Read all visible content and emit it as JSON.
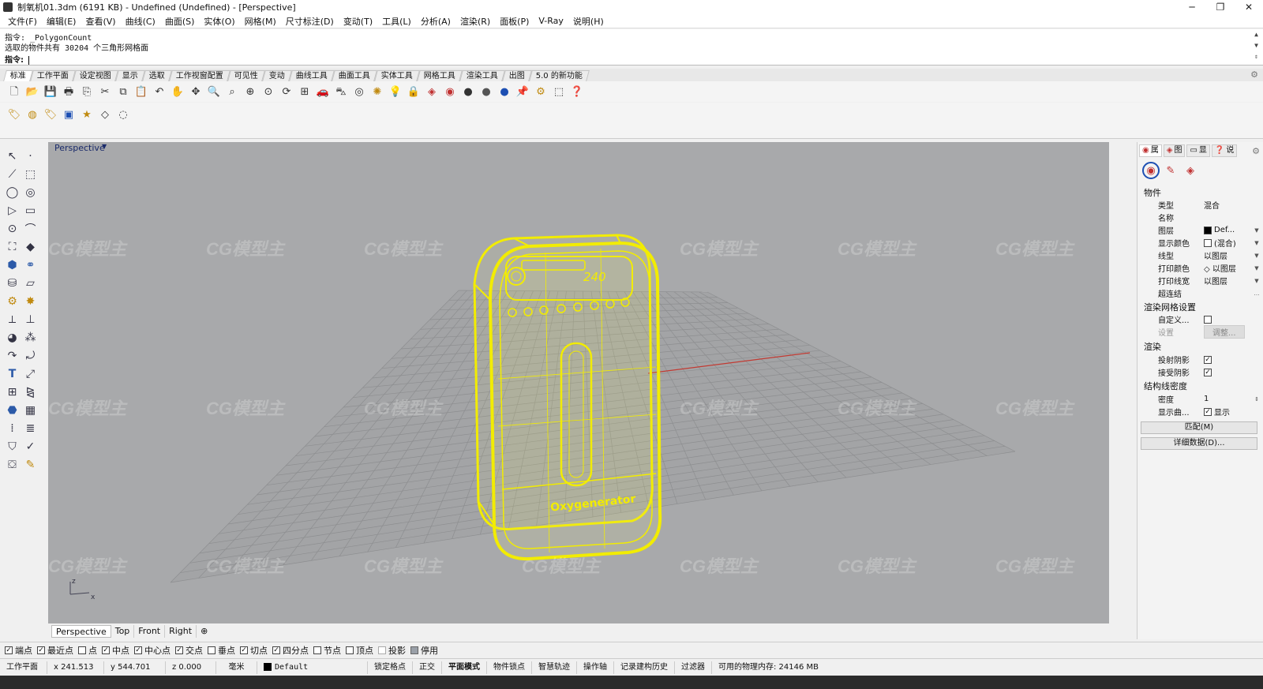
{
  "window": {
    "title": "制氧机01.3dm (6191 KB) - Undefined (Undefined) - [Perspective]",
    "controls": [
      "─",
      "❐",
      "✕"
    ]
  },
  "menu": [
    "文件(F)",
    "编辑(E)",
    "查看(V)",
    "曲线(C)",
    "曲面(S)",
    "实体(O)",
    "网格(M)",
    "尺寸标注(D)",
    "变动(T)",
    "工具(L)",
    "分析(A)",
    "渲染(R)",
    "面板(P)",
    "V-Ray",
    "说明(H)"
  ],
  "command": {
    "history_line1": "指令: _PolygonCount",
    "history_line2": "选取的物件共有 30204 个三角形网格面",
    "prompt": "指令:",
    "input_value": ""
  },
  "toolbar_tabs": [
    "标准",
    "工作平面",
    "设定视图",
    "显示",
    "选取",
    "工作视窗配置",
    "可见性",
    "变动",
    "曲线工具",
    "曲面工具",
    "实体工具",
    "网格工具",
    "渲染工具",
    "出图",
    "5.0 的新功能"
  ],
  "toolbar_icons": [
    "new-icon",
    "open-icon",
    "save-icon",
    "print-icon",
    "import-icon",
    "cut-icon",
    "copy-icon",
    "paste-icon",
    "undo-icon",
    "pan-hand-icon",
    "move-view-icon",
    "zoom-icon",
    "zoom-window-icon",
    "zoom-extents-icon",
    "zoom-selected-icon",
    "rotate-view-icon",
    "four-view-icon",
    "car-icon",
    "car-2-icon",
    "circle-dots-icon",
    "light-icon",
    "bulb-icon",
    "lock-icon",
    "material-icon",
    "color-wheel-icon",
    "sphere-gray-icon",
    "sphere-dark-icon",
    "sphere-blue-icon",
    "pin-icon",
    "gear-tools-icon",
    "select-window-icon",
    "help-icon"
  ],
  "toolbar2_icons": [
    "tag-icon",
    "tag-2-icon",
    "tag-3-icon",
    "cube-icon",
    "star-icon",
    "tag-gray-icon",
    "circle-gray-icon"
  ],
  "left_tools": [
    "select-arrow-icon",
    "point-icon",
    "polyline-icon",
    "curve-icon",
    "circle-icon",
    "arc-icon",
    "triangle-icon",
    "rectangle-icon",
    "circle-2-icon",
    "fillet-icon",
    "point-edit-icon",
    "surface-icon",
    "box-icon",
    "boolean-icon",
    "cylinder-icon",
    "plane-icon",
    "gear-icon",
    "explode-icon",
    "split-icon",
    "join-icon",
    "shade-icon",
    "group-icon",
    "bend-icon",
    "twist-icon",
    "text-icon",
    "scale-icon",
    "array-icon",
    "mirror-icon",
    "solid-icon",
    "wall-icon",
    "grid-array-icon",
    "stack-icon",
    "analyze-icon",
    "check-icon",
    "render-icon",
    "paint-icon"
  ],
  "viewport": {
    "name": "Perspective",
    "model_label": "Oxygenerator",
    "display_value": "240",
    "axis_z": "z",
    "axis_x": "x",
    "watermark": "CG模型主"
  },
  "viewport_tabs": [
    "Perspective",
    "Top",
    "Front",
    "Right",
    "⊕"
  ],
  "osnap": [
    {
      "label": "端点",
      "checked": true
    },
    {
      "label": "最近点",
      "checked": true
    },
    {
      "label": "点",
      "checked": false
    },
    {
      "label": "中点",
      "checked": true
    },
    {
      "label": "中心点",
      "checked": true
    },
    {
      "label": "交点",
      "checked": true
    },
    {
      "label": "垂点",
      "checked": false
    },
    {
      "label": "切点",
      "checked": true
    },
    {
      "label": "四分点",
      "checked": true
    },
    {
      "label": "节点",
      "checked": false
    },
    {
      "label": "顶点",
      "checked": false
    },
    {
      "label": "投影",
      "checked": false
    },
    {
      "label": "停用",
      "checked": false
    }
  ],
  "status": {
    "cplane": "工作平面",
    "x": "x 241.513",
    "y": "y 544.701",
    "z": "z 0.000",
    "units": "毫米",
    "layer": "Default",
    "grid_snap": "锁定格点",
    "ortho": "正交",
    "planar": "平面模式",
    "osnap": "物件锁点",
    "smarttrack": "智慧轨迹",
    "gumball": "操作轴",
    "history": "记录建构历史",
    "filter": "过滤器",
    "memory": "可用的物理内存: 24146 MB"
  },
  "panel": {
    "tabs": [
      "属",
      "图",
      "显",
      "说"
    ],
    "tab_icons": [
      "properties-icon",
      "layers-icon",
      "display-icon",
      "help-icon"
    ],
    "section_object": "物件",
    "rows": [
      {
        "label": "类型",
        "value": "混合"
      },
      {
        "label": "名称",
        "value": ""
      },
      {
        "label": "图层",
        "value": "Def..."
      },
      {
        "label": "显示颜色",
        "value": "(混合)"
      },
      {
        "label": "线型",
        "value": "以图层"
      },
      {
        "label": "打印颜色",
        "value": "◇ 以图层"
      },
      {
        "label": "打印线宽",
        "value": "以图层"
      },
      {
        "label": "超连结",
        "value": ""
      }
    ],
    "section_mesh": "渲染网格设置",
    "mesh_custom_label": "自定义...",
    "mesh_settings_label": "设置",
    "mesh_adjust_button": "调整...",
    "section_render": "渲染",
    "cast_shadows": "投射阴影",
    "receive_shadows": "接受阴影",
    "section_isocurve": "结构线密度",
    "density_label": "密度",
    "density_value": "1",
    "show_curves_label": "显示曲...",
    "show_label": "显示",
    "match_button": "匹配(M)",
    "details_button": "详细数据(D)..."
  },
  "colors": {
    "viewport_bg": "#a8a9ab",
    "grid": "#8d8e90",
    "selection": "#f2ec00",
    "x_axis": "#c23a32"
  }
}
